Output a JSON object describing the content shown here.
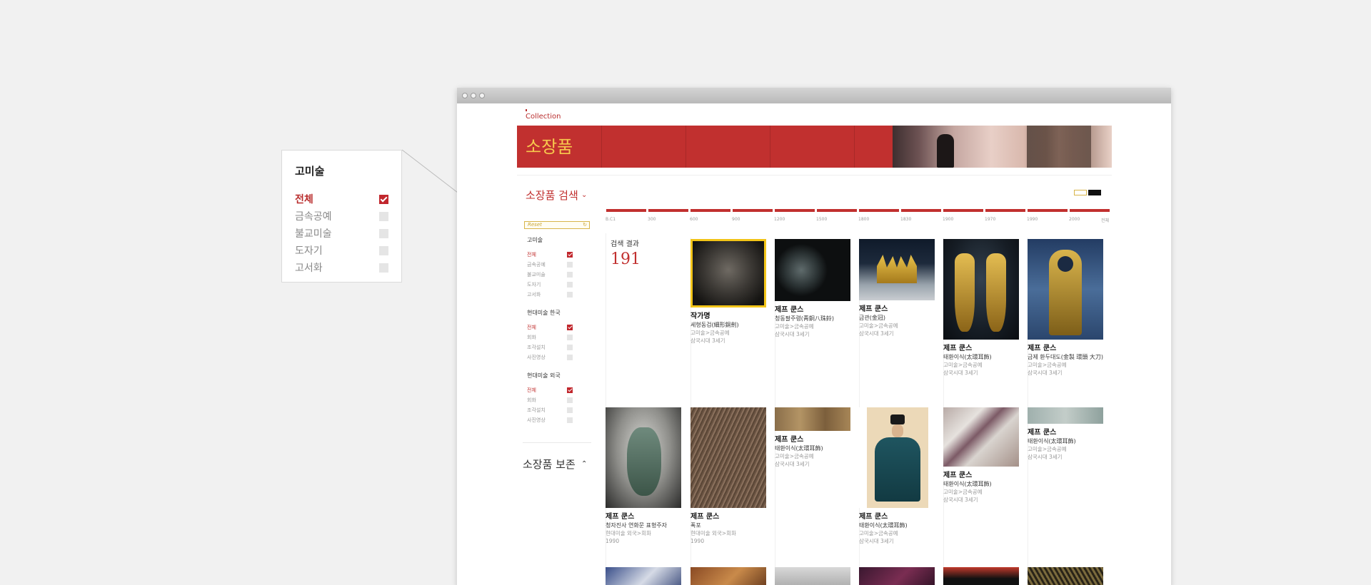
{
  "callout": {
    "title": "고미술",
    "items": [
      {
        "label": "전체",
        "checked": true
      },
      {
        "label": "금속공예",
        "checked": false
      },
      {
        "label": "불교미술",
        "checked": false
      },
      {
        "label": "도자기",
        "checked": false
      },
      {
        "label": "고서화",
        "checked": false
      }
    ]
  },
  "header": {
    "brand": "Collection",
    "hero_title": "소장품"
  },
  "search": {
    "title": "소장품 검색",
    "reset_label": "Reset"
  },
  "timeline": [
    "B.C1",
    "300",
    "600",
    "900",
    "1200",
    "1500",
    "1800",
    "1830",
    "1900",
    "1970",
    "1990",
    "2000",
    "전체"
  ],
  "filters": [
    {
      "title": "고미술",
      "items": [
        {
          "label": "전체",
          "checked": true
        },
        {
          "label": "금속공예",
          "checked": false
        },
        {
          "label": "불교미술",
          "checked": false
        },
        {
          "label": "도자기",
          "checked": false
        },
        {
          "label": "고서화",
          "checked": false
        }
      ]
    },
    {
      "title": "현대미술 한국",
      "items": [
        {
          "label": "전체",
          "checked": true
        },
        {
          "label": "회화",
          "checked": false
        },
        {
          "label": "조각설치",
          "checked": false
        },
        {
          "label": "사진영상",
          "checked": false
        }
      ]
    },
    {
      "title": "현대미술 외국",
      "items": [
        {
          "label": "전체",
          "checked": true
        },
        {
          "label": "회화",
          "checked": false
        },
        {
          "label": "조각설치",
          "checked": false
        },
        {
          "label": "사진영상",
          "checked": false
        }
      ]
    }
  ],
  "conservation_title": "소장품 보존",
  "results": {
    "label": "검색 결과",
    "count": "191"
  },
  "cards": [
    {
      "name": "작가명",
      "title": "세형동검(細形銅劍)",
      "category": "고미술>금속공예",
      "era": "삼국시대 3세기"
    },
    {
      "name": "제프 쿤스",
      "title": "청동팔주령(靑銅八珠鈴)",
      "category": "고미술>금속공예",
      "era": "삼국시대 3세기"
    },
    {
      "name": "제프 쿤스",
      "title": "금관(金冠)",
      "category": "고미술>금속공예",
      "era": "삼국시대 3세기"
    },
    {
      "name": "제프 쿤스",
      "title": "태환이식(太環耳飾)",
      "category": "고미술>금속공예",
      "era": "삼국시대 3세기"
    },
    {
      "name": "제프 쿤스",
      "title": "금제 환두대도(金製 環頭 大刀)",
      "category": "고미술>금속공예",
      "era": "삼국시대 3세기"
    },
    {
      "name": "제프 쿤스",
      "title": "청자진사 연화문 표형주자",
      "category": "현대미술 외국>회화",
      "era": "1990"
    },
    {
      "name": "제프 쿤스",
      "title": "폭포",
      "category": "현대미술 외국>회화",
      "era": "1990"
    },
    {
      "name": "제프 쿤스",
      "title": "태환이식(太環耳飾)",
      "category": "고미술>금속공예",
      "era": "삼국시대 3세기"
    },
    {
      "name": "제프 쿤스",
      "title": "태환이식(太環耳飾)",
      "category": "고미술>금속공예",
      "era": "삼국시대 3세기"
    },
    {
      "name": "제프 쿤스",
      "title": "태환이식(太環耳飾)",
      "category": "고미술>금속공예",
      "era": "삼국시대 3세기"
    },
    {
      "name": "제프 쿤스",
      "title": "태환이식(太環耳飾)",
      "category": "고미술>금속공예",
      "era": "삼국시대 3세기"
    }
  ],
  "colors": {
    "accent": "#c1302f",
    "hero_title": "#f7c94d",
    "highlight": "#f2c418"
  }
}
